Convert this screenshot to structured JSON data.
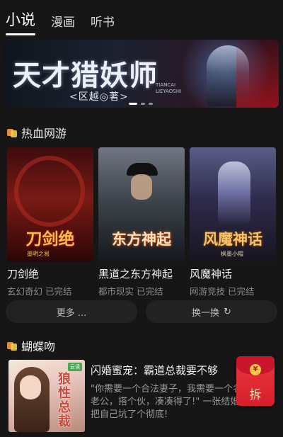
{
  "top_tabs": [
    {
      "label": "小说",
      "active": true
    },
    {
      "label": "漫画",
      "active": false
    },
    {
      "label": "听书",
      "active": false
    }
  ],
  "banner": {
    "title": "天才猎妖师",
    "author": "<区越◎著>",
    "pinyin_line1": "TIANCAI",
    "pinyin_line2": "LIEYAOSHI",
    "slides": 3,
    "active_slide": 1
  },
  "section1": {
    "title": "热血网游",
    "books": [
      {
        "title": "刀剑绝",
        "meta": "玄幻奇幻 已完结",
        "cover_text": "刀剑绝",
        "cover_sub": "墨明之易"
      },
      {
        "title": "黑道之东方神起",
        "meta": "都市现实 已完结",
        "cover_text": "东方神起",
        "cover_sub": ""
      },
      {
        "title": "风魔神话",
        "meta": "网游竞技 已完结",
        "cover_text": "风魔神话",
        "cover_sub": "枫墨小帽"
      }
    ],
    "more_label": "更多 ...",
    "refresh_label": "换一换",
    "refresh_icon": "↻"
  },
  "section2": {
    "title": "蝴蝶吻",
    "book": {
      "title": "闪婚蜜宠：霸道总裁要不够",
      "desc": "\"你需要一个合法妻子，我需要一个名义上的老公，搭个伙，凑凑得了!\" 一张结婚证，她把自己坑了个彻底!",
      "cover_text": "狼性总裁",
      "cover_tag": "云读"
    }
  },
  "red_packet": {
    "label": "拆",
    "coin": "¥"
  },
  "colors": {
    "background": "#161616",
    "accent_orange": "#e98a3a",
    "red_packet": "#e1293a"
  }
}
